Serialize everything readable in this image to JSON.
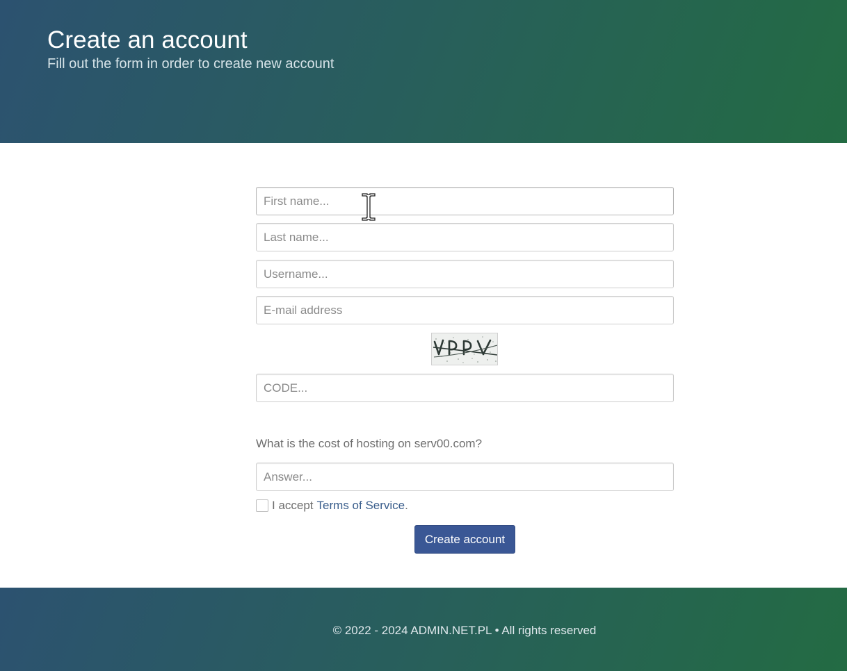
{
  "header": {
    "title": "Create an account",
    "subtitle": "Fill out the form in order to create new account"
  },
  "form": {
    "first_name": {
      "placeholder": "First name..."
    },
    "last_name": {
      "placeholder": "Last name..."
    },
    "username": {
      "placeholder": "Username..."
    },
    "email": {
      "placeholder": "E-mail address"
    },
    "code": {
      "placeholder": "CODE..."
    },
    "question": "What is the cost of hosting on serv00.com?",
    "answer": {
      "placeholder": "Answer..."
    },
    "tos_prefix": "I accept",
    "tos_link": "Terms of Service",
    "tos_suffix": ".",
    "submit_label": "Create account"
  },
  "footer": {
    "copyright": "© 2022 - 2024 ADMIN.NET.PL • All rights reserved"
  },
  "colors": {
    "header_gradient_start": "#2c5270",
    "header_gradient_end": "#236b43",
    "button": "#3a5795",
    "link": "#3a5e8c"
  },
  "icons": {
    "captcha": "captcha-image",
    "cursor": "text-cursor-icon"
  }
}
